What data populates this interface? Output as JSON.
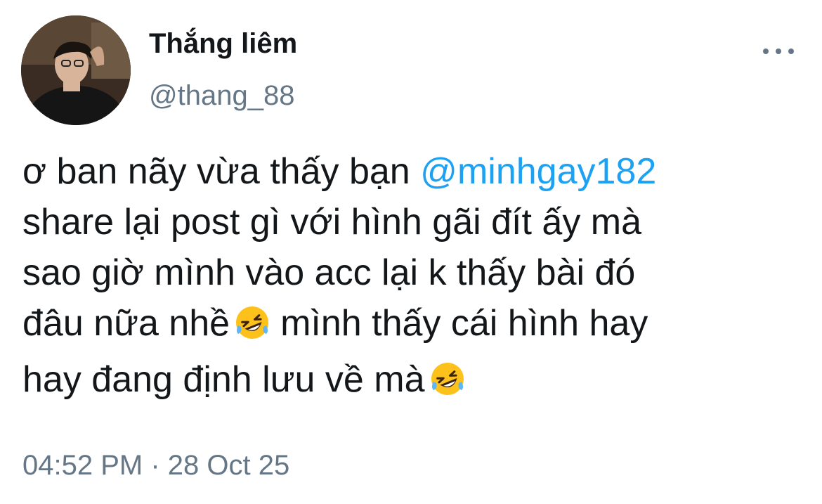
{
  "tweet": {
    "author": {
      "display_name": "Thắng liêm",
      "handle": "@thang_88"
    },
    "text": {
      "l1_before": "ơ ban nãy vừa thấy bạn ",
      "l1_mention": "@minhgay182",
      "l2": "share lại post gì với hình gãi đít ấy mà",
      "l3": "sao giờ mình vào acc lại k thấy bài đó",
      "l4_before": "đâu nữa nhề",
      "l4_after": "mình thấy cái hình hay",
      "l5_before": "hay đang định lưu về mà"
    },
    "emoji": "rolling-on-the-floor-laughing",
    "time": "04:52 PM",
    "separator": "·",
    "date": "28 Oct 25"
  },
  "colors": {
    "text": "#14171a",
    "secondary": "#657786",
    "link": "#1da1f2",
    "background": "#ffffff"
  }
}
